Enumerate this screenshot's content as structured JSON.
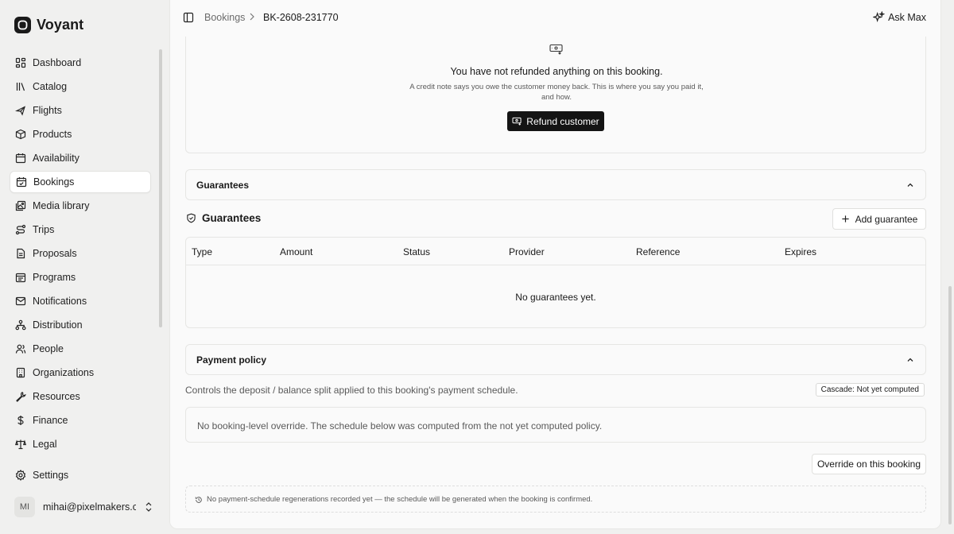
{
  "app": {
    "name": "Voyant"
  },
  "sidebar": {
    "items": [
      {
        "label": "Dashboard",
        "icon": "dashboard-icon",
        "active": false
      },
      {
        "label": "Catalog",
        "icon": "library-icon",
        "active": false
      },
      {
        "label": "Flights",
        "icon": "plane-icon",
        "active": false
      },
      {
        "label": "Products",
        "icon": "package-icon",
        "active": false
      },
      {
        "label": "Availability",
        "icon": "calendar-icon",
        "active": false
      },
      {
        "label": "Bookings",
        "icon": "calendar-check-icon",
        "active": true
      },
      {
        "label": "Media library",
        "icon": "images-icon",
        "active": false
      },
      {
        "label": "Trips",
        "icon": "route-icon",
        "active": false
      },
      {
        "label": "Proposals",
        "icon": "file-text-icon",
        "active": false
      },
      {
        "label": "Programs",
        "icon": "calendar-range-icon",
        "active": false
      },
      {
        "label": "Notifications",
        "icon": "mail-icon",
        "active": false
      },
      {
        "label": "Distribution",
        "icon": "network-icon",
        "active": false
      },
      {
        "label": "People",
        "icon": "users-icon",
        "active": false
      },
      {
        "label": "Organizations",
        "icon": "building-icon",
        "active": false
      },
      {
        "label": "Resources",
        "icon": "wrench-icon",
        "active": false
      },
      {
        "label": "Finance",
        "icon": "dollar-icon",
        "active": false
      },
      {
        "label": "Legal",
        "icon": "scale-icon",
        "active": false
      }
    ],
    "settings_label": "Settings",
    "user": {
      "initials": "MI",
      "email": "mihai@pixelmakers.c..."
    }
  },
  "topbar": {
    "breadcrumb": [
      "Bookings",
      "BK-2608-231770"
    ],
    "ask_label": "Ask Max"
  },
  "refund": {
    "title": "You have not refunded anything on this booking.",
    "description": "A credit note says you owe the customer money back. This is where you say you paid it, and how.",
    "button_label": "Refund customer"
  },
  "guarantees": {
    "section_label": "Guarantees",
    "title": "Guarantees",
    "add_button_label": "Add guarantee",
    "columns": [
      "Type",
      "Amount",
      "Status",
      "Provider",
      "Reference",
      "Expires"
    ],
    "empty_message": "No guarantees yet."
  },
  "payment_policy": {
    "section_label": "Payment policy",
    "description": "Controls the deposit / balance split applied to this booking's payment schedule.",
    "cascade_badge": "Cascade: Not yet computed",
    "override_text": "No booking-level override. The schedule below was computed from the not yet computed policy.",
    "override_button_label": "Override on this booking",
    "regen_text": "No payment-schedule regenerations recorded yet — the schedule will be generated when the booking is confirmed."
  }
}
